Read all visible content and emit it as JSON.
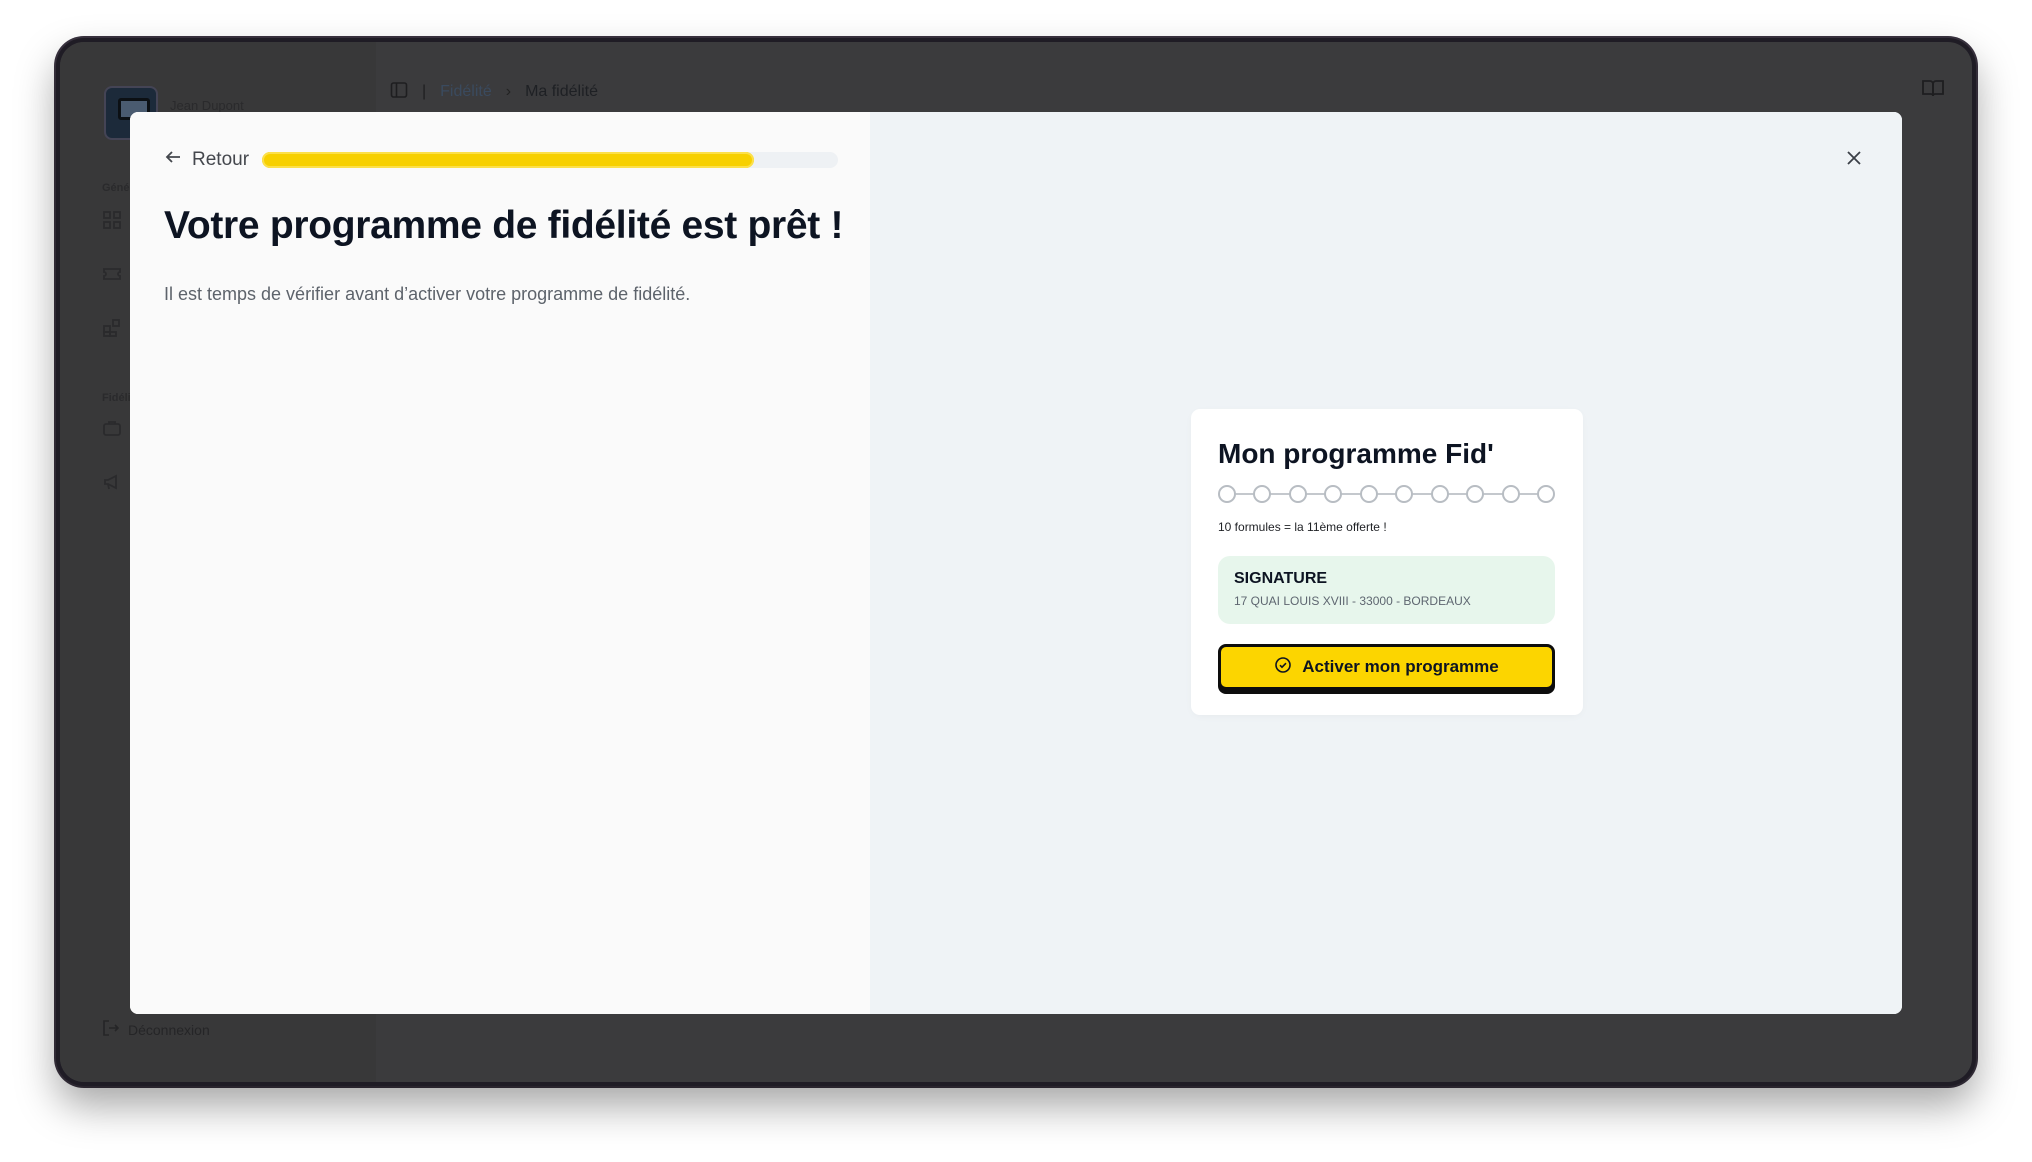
{
  "sidebar": {
    "user_name": "Jean Dupont",
    "section_general": "Géné",
    "section_fidelite": "Fidéli",
    "logout_label": "Déconnexion"
  },
  "topbar": {
    "breadcrumb_parent": "Fidélité",
    "breadcrumb_separator": "›",
    "breadcrumb_current": "Ma fidélité"
  },
  "modal": {
    "back_label": "Retour",
    "progress_fraction": 0.855,
    "title": "Votre programme de fidélité est prêt !",
    "subtitle": "Il est temps de vérifier avant d’activer votre programme de fidélité."
  },
  "card": {
    "title": "Mon programme Fid'",
    "stamp_count": 10,
    "caption": "10 formules = la 11ème offerte !",
    "shop_name": "SIGNATURE",
    "shop_address": "17 QUAI LOUIS XVIII - 33000 - BORDEAUX",
    "activate_label": "Activer mon programme"
  },
  "colors": {
    "accent_yellow": "#fcd500",
    "shop_box_green": "#e7f6ec",
    "title_dark": "#0d1422"
  }
}
